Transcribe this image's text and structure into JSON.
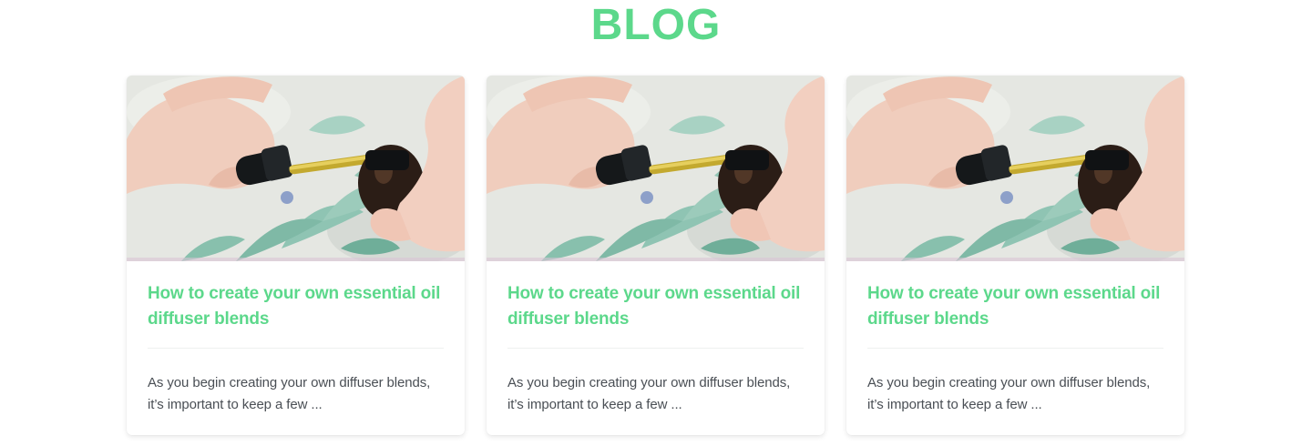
{
  "section": {
    "title": "BLOG"
  },
  "posts": [
    {
      "title": "How to create your own essential oil diffuser blends",
      "excerpt": "As you begin creating your own diffuser blends, it’s important to keep a few ...",
      "image_icon": "essential-oil-dropper-photo"
    },
    {
      "title": "How to create your own essential oil diffuser blends",
      "excerpt": "As you begin creating your own diffuser blends, it’s important to keep a few ...",
      "image_icon": "essential-oil-dropper-photo"
    },
    {
      "title": "How to create your own essential oil diffuser blends",
      "excerpt": "As you begin creating your own diffuser blends, it’s important to keep a few ...",
      "image_icon": "essential-oil-dropper-photo"
    }
  ],
  "colors": {
    "accent": "#5cd88b",
    "text_body": "#4a4f55",
    "divider": "#eef0ef"
  }
}
